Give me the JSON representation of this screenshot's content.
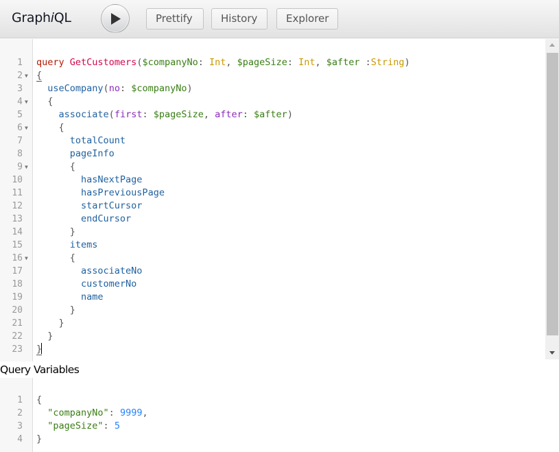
{
  "header": {
    "title_prefix": "Graph",
    "title_italic": "i",
    "title_suffix": "QL",
    "execute_label": "Execute Query",
    "buttons": {
      "prettify": "Prettify",
      "history": "History",
      "explorer": "Explorer"
    }
  },
  "query_editor": {
    "lines": [
      {
        "n": "1",
        "fold": false,
        "tokens": [
          [
            "t-kw",
            "query"
          ],
          [
            "t-punc",
            " "
          ],
          [
            "t-def",
            "GetCustomers"
          ],
          [
            "t-punc",
            "("
          ],
          [
            "t-var",
            "$companyNo"
          ],
          [
            "t-punc",
            ": "
          ],
          [
            "t-type",
            "Int"
          ],
          [
            "t-punc",
            ", "
          ],
          [
            "t-var",
            "$pageSize"
          ],
          [
            "t-punc",
            ": "
          ],
          [
            "t-type",
            "Int"
          ],
          [
            "t-punc",
            ", "
          ],
          [
            "t-var",
            "$after"
          ],
          [
            "t-punc",
            " :"
          ],
          [
            "t-type",
            "String"
          ],
          [
            "t-punc",
            ")"
          ]
        ]
      },
      {
        "n": "2",
        "fold": true,
        "tokens": [
          [
            "t-punc match",
            "{"
          ]
        ]
      },
      {
        "n": "3",
        "fold": false,
        "tokens": [
          [
            "t-punc",
            "  "
          ],
          [
            "t-prop",
            "useCompany"
          ],
          [
            "t-punc",
            "("
          ],
          [
            "t-attr",
            "no"
          ],
          [
            "t-punc",
            ": "
          ],
          [
            "t-var",
            "$companyNo"
          ],
          [
            "t-punc",
            ")"
          ]
        ]
      },
      {
        "n": "4",
        "fold": true,
        "tokens": [
          [
            "t-punc",
            "  {"
          ]
        ]
      },
      {
        "n": "5",
        "fold": false,
        "tokens": [
          [
            "t-punc",
            "    "
          ],
          [
            "t-prop",
            "associate"
          ],
          [
            "t-punc",
            "("
          ],
          [
            "t-attr",
            "first"
          ],
          [
            "t-punc",
            ": "
          ],
          [
            "t-var",
            "$pageSize"
          ],
          [
            "t-punc",
            ", "
          ],
          [
            "t-attr",
            "after"
          ],
          [
            "t-punc",
            ": "
          ],
          [
            "t-var",
            "$after"
          ],
          [
            "t-punc",
            ")"
          ]
        ]
      },
      {
        "n": "6",
        "fold": true,
        "tokens": [
          [
            "t-punc",
            "    {"
          ]
        ]
      },
      {
        "n": "7",
        "fold": false,
        "tokens": [
          [
            "t-punc",
            "      "
          ],
          [
            "t-prop",
            "totalCount"
          ]
        ]
      },
      {
        "n": "8",
        "fold": false,
        "tokens": [
          [
            "t-punc",
            "      "
          ],
          [
            "t-prop",
            "pageInfo"
          ]
        ]
      },
      {
        "n": "9",
        "fold": true,
        "tokens": [
          [
            "t-punc",
            "      {"
          ]
        ]
      },
      {
        "n": "10",
        "fold": false,
        "tokens": [
          [
            "t-punc",
            "        "
          ],
          [
            "t-prop",
            "hasNextPage"
          ]
        ]
      },
      {
        "n": "11",
        "fold": false,
        "tokens": [
          [
            "t-punc",
            "        "
          ],
          [
            "t-prop",
            "hasPreviousPage"
          ]
        ]
      },
      {
        "n": "12",
        "fold": false,
        "tokens": [
          [
            "t-punc",
            "        "
          ],
          [
            "t-prop",
            "startCursor"
          ]
        ]
      },
      {
        "n": "13",
        "fold": false,
        "tokens": [
          [
            "t-punc",
            "        "
          ],
          [
            "t-prop",
            "endCursor"
          ]
        ]
      },
      {
        "n": "14",
        "fold": false,
        "tokens": [
          [
            "t-punc",
            "      }"
          ]
        ]
      },
      {
        "n": "15",
        "fold": false,
        "tokens": [
          [
            "t-punc",
            "      "
          ],
          [
            "t-prop",
            "items"
          ]
        ]
      },
      {
        "n": "16",
        "fold": true,
        "tokens": [
          [
            "t-punc",
            "      {"
          ]
        ]
      },
      {
        "n": "17",
        "fold": false,
        "tokens": [
          [
            "t-punc",
            "        "
          ],
          [
            "t-prop",
            "associateNo"
          ]
        ]
      },
      {
        "n": "18",
        "fold": false,
        "tokens": [
          [
            "t-punc",
            "        "
          ],
          [
            "t-prop",
            "customerNo"
          ]
        ]
      },
      {
        "n": "19",
        "fold": false,
        "tokens": [
          [
            "t-punc",
            "        "
          ],
          [
            "t-prop",
            "name"
          ]
        ]
      },
      {
        "n": "20",
        "fold": false,
        "tokens": [
          [
            "t-punc",
            "      }"
          ]
        ]
      },
      {
        "n": "21",
        "fold": false,
        "tokens": [
          [
            "t-punc",
            "    }"
          ]
        ]
      },
      {
        "n": "22",
        "fold": false,
        "tokens": [
          [
            "t-punc",
            "  }"
          ]
        ]
      },
      {
        "n": "23",
        "fold": false,
        "cursor": true,
        "tokens": [
          [
            "t-punc match",
            "}"
          ]
        ]
      }
    ]
  },
  "variables": {
    "title": "Query Variables",
    "lines": [
      {
        "n": "1",
        "tokens": [
          [
            "t-punc",
            "{"
          ]
        ]
      },
      {
        "n": "2",
        "tokens": [
          [
            "t-punc",
            "  "
          ],
          [
            "t-str",
            "\"companyNo\""
          ],
          [
            "t-punc",
            ": "
          ],
          [
            "t-num",
            "9999"
          ],
          [
            "t-punc",
            ","
          ]
        ]
      },
      {
        "n": "3",
        "tokens": [
          [
            "t-punc",
            "  "
          ],
          [
            "t-str",
            "\"pageSize\""
          ],
          [
            "t-punc",
            ": "
          ],
          [
            "t-num",
            "5"
          ]
        ]
      },
      {
        "n": "4",
        "tokens": [
          [
            "t-punc",
            "}"
          ]
        ]
      }
    ],
    "values": {
      "companyNo": 9999,
      "pageSize": 5
    }
  },
  "colors": {
    "keyword": "#B11A04",
    "definition": "#D2054E",
    "variable": "#397D13",
    "type": "#CA9800",
    "field": "#1F61A0",
    "argument": "#8B2BB9",
    "number": "#2882F9"
  }
}
